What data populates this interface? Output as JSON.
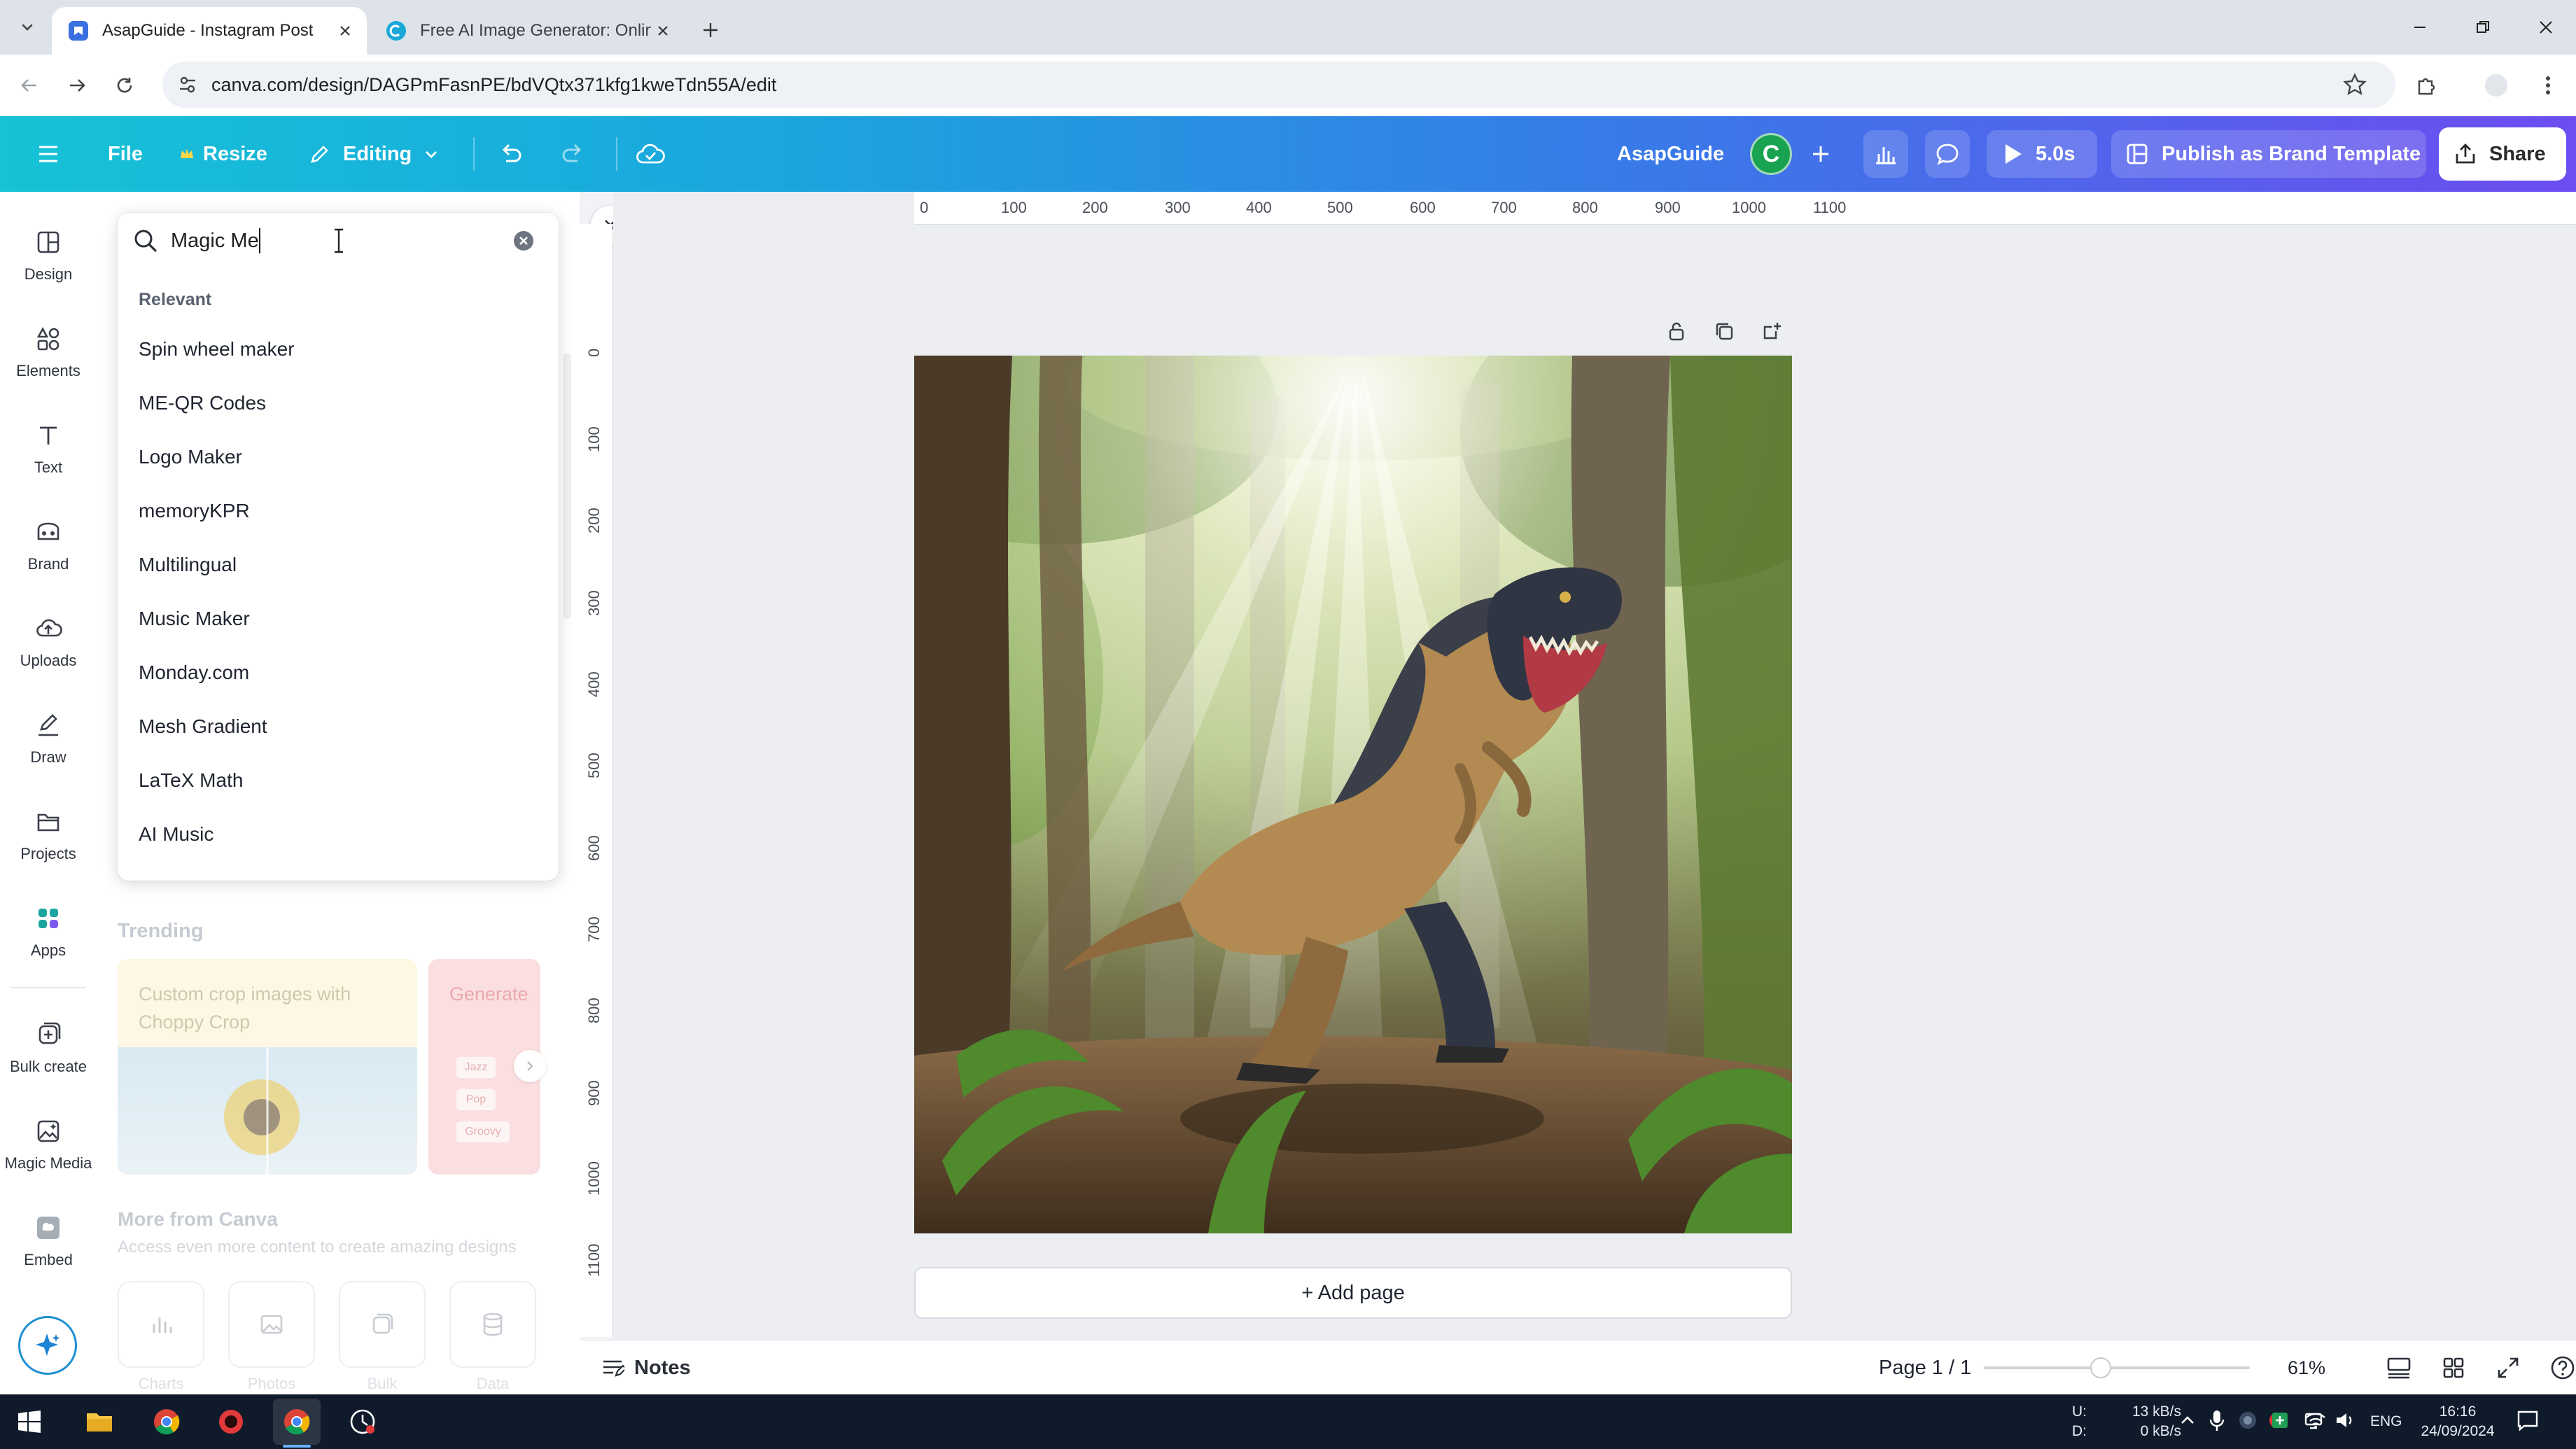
{
  "browser": {
    "tabs": [
      {
        "title": "AsapGuide - Instagram Post",
        "active": true,
        "favicon": "canva-favicon"
      },
      {
        "title": "Free AI Image Generator: Onlin",
        "active": false,
        "favicon": "canva-favicon"
      }
    ],
    "url": "canva.com/design/DAGPmFasnPE/bdVQtx371kfg1kweTdn55A/edit"
  },
  "topbar": {
    "file_label": "File",
    "resize_label": "Resize",
    "editing_label": "Editing",
    "design_name": "AsapGuide",
    "avatar_initial": "C",
    "timer_label": "5.0s",
    "publish_label": "Publish as Brand Template",
    "share_label": "Share"
  },
  "rail": {
    "items": [
      {
        "label": "Design",
        "icon": "design-icon"
      },
      {
        "label": "Elements",
        "icon": "elements-icon"
      },
      {
        "label": "Text",
        "icon": "text-icon"
      },
      {
        "label": "Brand",
        "icon": "brand-icon"
      },
      {
        "label": "Uploads",
        "icon": "uploads-icon"
      },
      {
        "label": "Draw",
        "icon": "draw-icon"
      },
      {
        "label": "Projects",
        "icon": "projects-icon"
      },
      {
        "label": "Apps",
        "icon": "apps-icon"
      },
      {
        "label": "Bulk create",
        "icon": "bulk-create-icon"
      },
      {
        "label": "Magic Media",
        "icon": "magic-media-icon"
      },
      {
        "label": "Embed",
        "icon": "embed-icon"
      }
    ]
  },
  "search": {
    "value": "Magic Me",
    "section_label": "Relevant",
    "suggestions": [
      "Spin wheel maker",
      "ME-QR Codes",
      "Logo Maker",
      "memoryKPR",
      "Multilingual",
      "Music Maker",
      "Monday.com",
      "Mesh Gradient",
      "LaTeX Math",
      "AI Music"
    ]
  },
  "panel_background": {
    "trending_label": "Trending",
    "card1_text": "Custom crop images with Choppy Crop",
    "card2_text": "Generate AI Music",
    "card2_tags": [
      "Jazz",
      "Pop",
      "Groovy"
    ],
    "more_title": "More from Canva",
    "more_subtitle": "Access even more content to create amazing designs",
    "more_items": [
      "Charts",
      "Photos",
      "Bulk",
      "Data"
    ]
  },
  "rulers": {
    "top": [
      "0",
      "100",
      "200",
      "300",
      "400",
      "500",
      "600",
      "700",
      "800",
      "900",
      "1000",
      "1100"
    ],
    "left": [
      "0",
      "100",
      "200",
      "300",
      "400",
      "500",
      "600",
      "700",
      "800",
      "900",
      "1000",
      "1100"
    ]
  },
  "canvas": {
    "add_page_label": "+ Add page"
  },
  "statusbar": {
    "notes_label": "Notes",
    "page_info": "Page 1 / 1",
    "zoom": "61%",
    "zoom_fraction": 0.44
  },
  "taskbar": {
    "net_up_label": "U:",
    "net_down_label": "D:",
    "net_up": "13 kB/s",
    "net_down": "0 kB/s",
    "language": "ENG",
    "time": "16:16",
    "date": "24/09/2024"
  },
  "colors": {
    "canva_gradient_start": "#16c2d6",
    "canva_gradient_end": "#6d4df0",
    "avatar": "#19a351",
    "apps_icon": "#1ba5a1"
  }
}
